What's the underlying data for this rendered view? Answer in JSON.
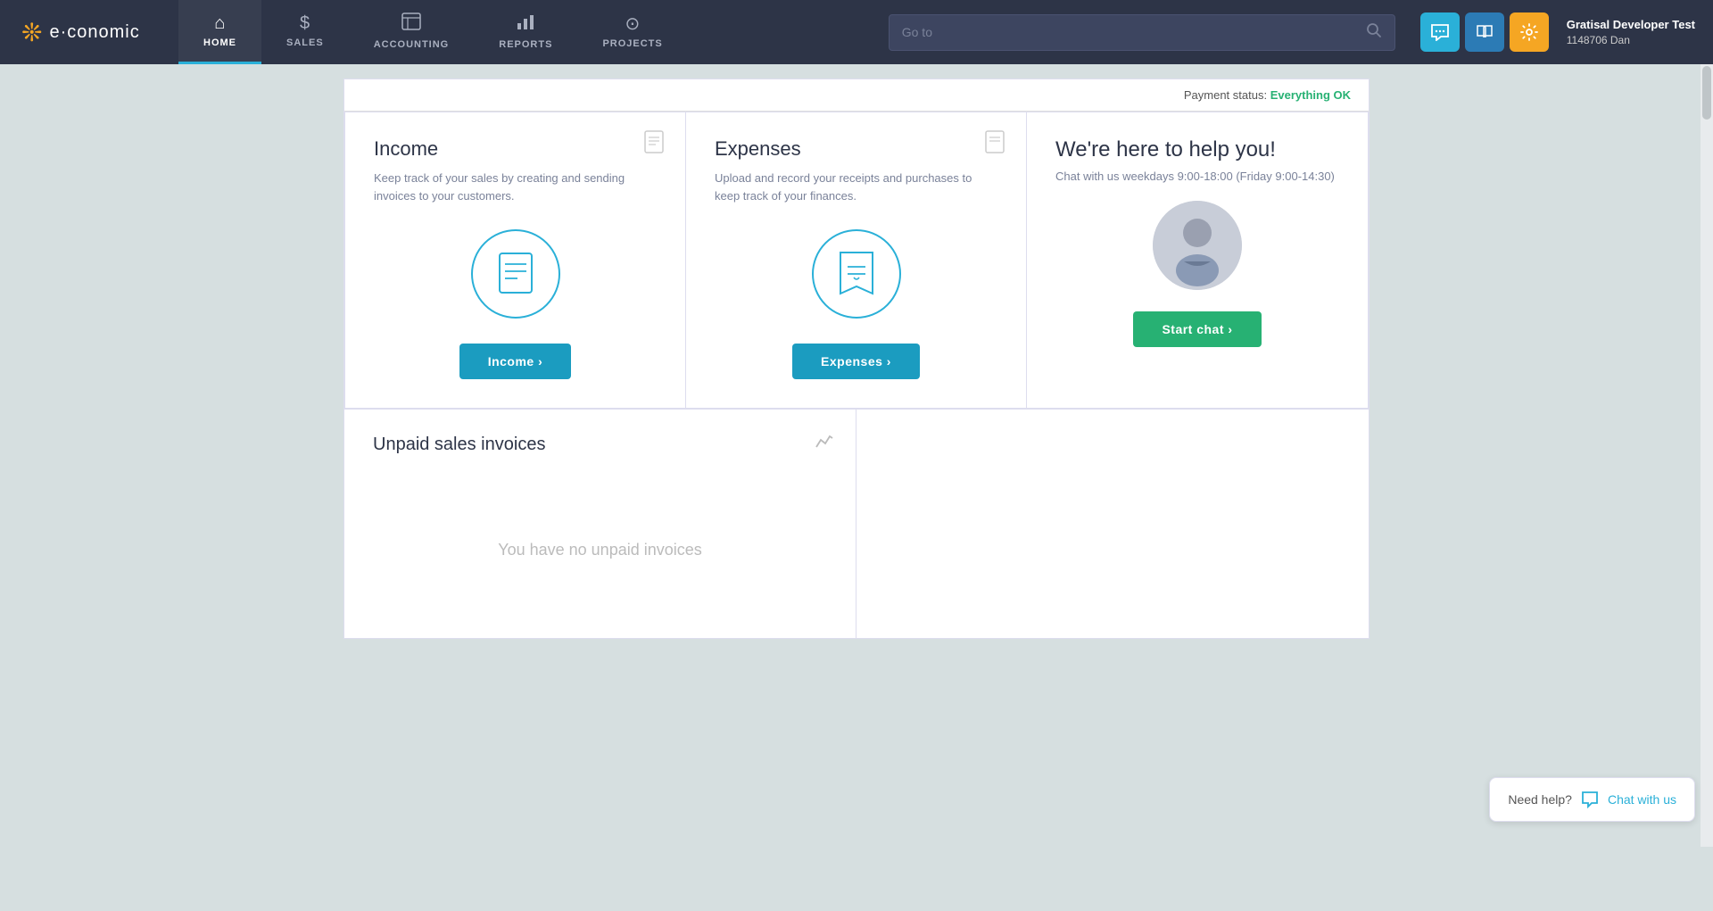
{
  "nav": {
    "logo_text": "e·conomic",
    "items": [
      {
        "id": "home",
        "label": "HOME",
        "icon": "⌂",
        "active": true
      },
      {
        "id": "sales",
        "label": "SALES",
        "icon": "$"
      },
      {
        "id": "accounting",
        "label": "ACCOUNTING",
        "icon": "⊞"
      },
      {
        "id": "reports",
        "label": "REPORTS",
        "icon": "⊿"
      },
      {
        "id": "projects",
        "label": "PROJECTS",
        "icon": "⊙"
      }
    ],
    "search_placeholder": "Go to",
    "user_name": "Gratisal Developer Test",
    "user_id": "1148706 Dan"
  },
  "payment_status": {
    "label": "Payment status:",
    "value": "Everything OK"
  },
  "income_card": {
    "title": "Income",
    "description": "Keep track of your sales by creating and sending invoices to your customers.",
    "button_label": "Income ›"
  },
  "expenses_card": {
    "title": "Expenses",
    "description": "Upload and record your receipts and purchases to keep track of your finances.",
    "button_label": "Expenses ›"
  },
  "help_card": {
    "title": "We're here to help you!",
    "description": "Chat with us weekdays 9:00-18:00 (Friday 9:00-14:30)",
    "button_label": "Start chat ›"
  },
  "unpaid_invoices": {
    "title": "Unpaid sales invoices",
    "empty_message": "You have no unpaid invoices"
  },
  "help_widget": {
    "label": "Need help?",
    "chat_label": "Chat with us"
  }
}
